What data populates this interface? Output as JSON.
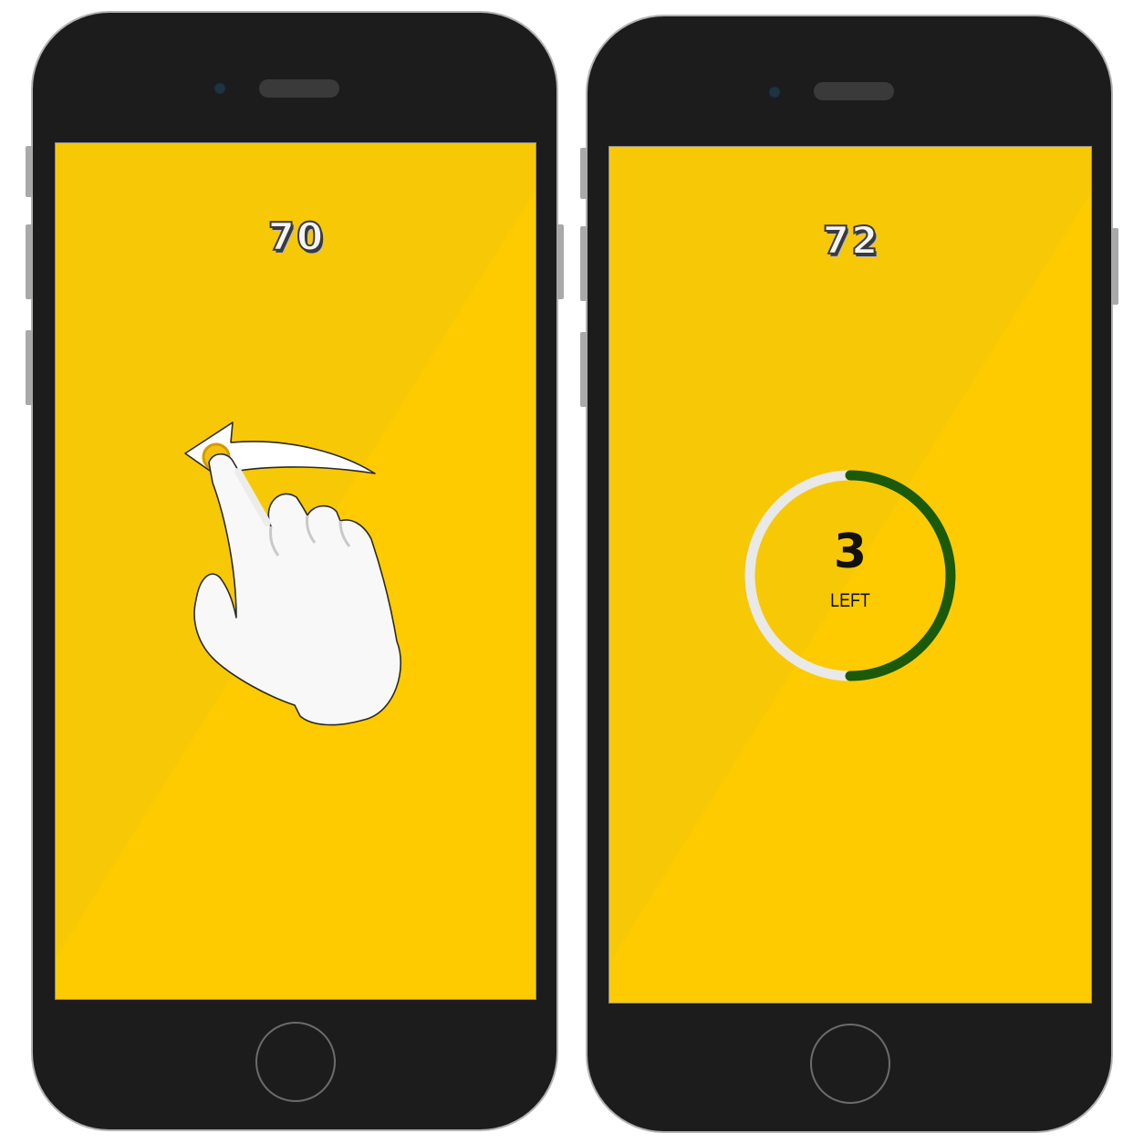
{
  "screens": [
    {
      "score": "70",
      "gesture_icon": "swipe-left-hand-icon"
    },
    {
      "score": "72",
      "countdown": {
        "value": "3",
        "label": "LEFT",
        "progress_fraction": 0.5,
        "track_color": "#e9e9e9",
        "progress_color": "#1a5a0a"
      }
    }
  ],
  "colors": {
    "phone_body": "#1c1c1c",
    "screen_background": "#fdcb00"
  }
}
